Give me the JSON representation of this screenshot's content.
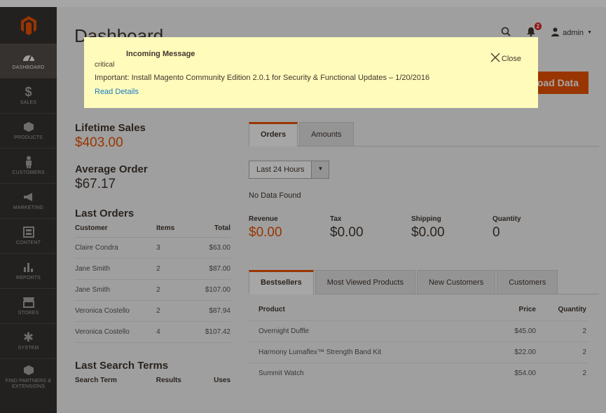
{
  "page": {
    "title": "Dashboard"
  },
  "header": {
    "user": "admin",
    "notification_count": "2"
  },
  "reload_button": "oad Data",
  "sidebar": {
    "items": [
      {
        "label": "Dashboard",
        "icon": "speedometer-icon",
        "active": true
      },
      {
        "label": "Sales",
        "icon": "dollar-icon"
      },
      {
        "label": "Products",
        "icon": "cube-icon"
      },
      {
        "label": "Customers",
        "icon": "person-icon"
      },
      {
        "label": "Marketing",
        "icon": "megaphone-icon"
      },
      {
        "label": "Content",
        "icon": "layout-icon"
      },
      {
        "label": "Reports",
        "icon": "bar-chart-icon"
      },
      {
        "label": "Stores",
        "icon": "storefront-icon"
      },
      {
        "label": "System",
        "icon": "gear-icon"
      },
      {
        "label": "Find Partners & Extensions",
        "icon": "puzzle-icon"
      }
    ]
  },
  "stats": {
    "lifetime_sales_label": "Lifetime Sales",
    "lifetime_sales_value": "$403.00",
    "average_order_label": "Average Order",
    "average_order_value": "$67.17"
  },
  "last_orders": {
    "title": "Last Orders",
    "headers": [
      "Customer",
      "Items",
      "Total"
    ],
    "rows": [
      [
        "Claire Condra",
        "3",
        "$63.00"
      ],
      [
        "Jane Smith",
        "2",
        "$87.00"
      ],
      [
        "Jane Smith",
        "2",
        "$107.00"
      ],
      [
        "Veronica Costello",
        "2",
        "$87.94"
      ],
      [
        "Veronica Costello",
        "4",
        "$107.42"
      ]
    ]
  },
  "last_search": {
    "title": "Last Search Terms",
    "headers": [
      "Search Term",
      "Results",
      "Uses"
    ]
  },
  "chart_tabs": [
    "Orders",
    "Amounts"
  ],
  "period_select": "Last 24 Hours",
  "no_data": "No Data Found",
  "metrics": [
    {
      "label": "Revenue",
      "value": "$0.00"
    },
    {
      "label": "Tax",
      "value": "$0.00"
    },
    {
      "label": "Shipping",
      "value": "$0.00"
    },
    {
      "label": "Quantity",
      "value": "0"
    }
  ],
  "grid_tabs": [
    "Bestsellers",
    "Most Viewed Products",
    "New Customers",
    "Customers"
  ],
  "bestsellers": {
    "headers": [
      "Product",
      "Price",
      "Quantity"
    ],
    "rows": [
      [
        "Overnight Duffle",
        "$45.00",
        "2"
      ],
      [
        "Harmony Lumaflex™ Strength Band Kit",
        "$22.00",
        "2"
      ],
      [
        "Summit Watch",
        "$54.00",
        "2"
      ]
    ]
  },
  "modal": {
    "title": "Incoming Message",
    "severity": "critical",
    "text": "Important: Install Magento Community Edition 2.0.1 for Security & Functional Updates – 1/20/2016",
    "link": "Read Details",
    "close": "Close"
  }
}
